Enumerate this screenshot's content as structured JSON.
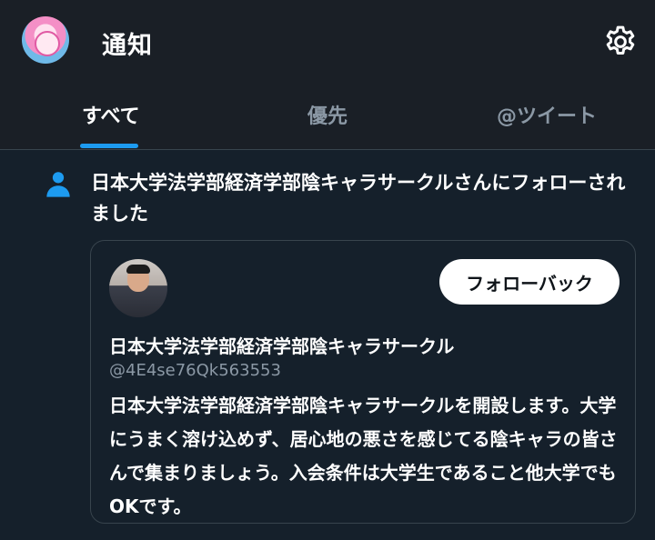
{
  "header": {
    "title": "通知",
    "avatar_icon": "user-avatar",
    "settings_icon": "gear-icon"
  },
  "tabs": [
    {
      "label": "すべて",
      "active": true
    },
    {
      "label": "優先",
      "active": false
    },
    {
      "label": "@ツイート",
      "active": false
    }
  ],
  "notification": {
    "icon": "person-icon",
    "text": "日本大学法学部経済学部陰キャラサークルさんにフォローされました",
    "account": {
      "display_name": "日本大学法学部経済学部陰キャラサークル",
      "handle": "@4E4se76Qk563553",
      "bio": "日本大学法学部経済学部陰キャラサークルを開設します。大学にうまく溶け込めず、居心地の悪さを感じてる陰キャラの皆さんで集まりましょう。入会条件は大学生であること他大学でもOKです。",
      "follow_button": "フォローバック"
    }
  },
  "colors": {
    "background": "#15202b",
    "header_bg": "#1a1f26",
    "accent": "#1d9bf0",
    "muted": "#8b98a5",
    "border": "#38444d"
  }
}
